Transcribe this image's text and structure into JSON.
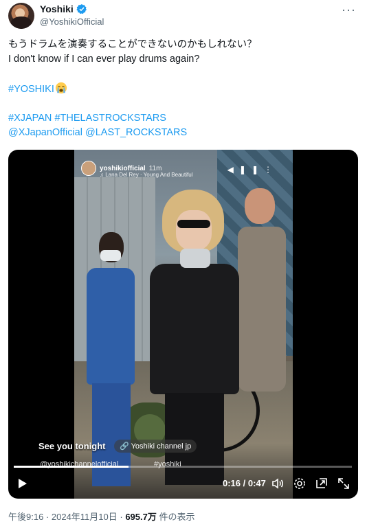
{
  "user": {
    "display_name": "Yoshiki",
    "handle": "@YoshikiOfficial",
    "verified": true
  },
  "tweet": {
    "text_jp": "もうドラムを演奏することができないのかもしれない？",
    "text_en": "I don't know if I can ever play drums again?",
    "hashtag_main": "#YOSHIKI",
    "emoji": "crying-face-emoji",
    "hashtag_xjapan": "#XJAPAN",
    "hashtag_lastrockstars": "#THELASTROCKSTARS",
    "mention_xjapan": "@XJapanOfficial",
    "mention_lastrockstars": "@LAST_ROCKSTARS"
  },
  "video": {
    "story_user": "yoshikiofficial",
    "story_time": "11m",
    "story_song": "♫ Lana Del Rey · Young And Beautiful",
    "overlay_text": "See you tonight",
    "channel_label": "Yoshiki channel jp",
    "tag_official": "@yoshikichannelofficial",
    "tag_yoshiki": "#yoshiki",
    "current_time": "0:16",
    "separator": " / ",
    "duration": "0:47",
    "progress": 0.34
  },
  "meta": {
    "time": "午後9:16",
    "dot1": " · ",
    "date": "2024年11月10日",
    "dot2": " · ",
    "views": "695.7万",
    "views_label": " 件の表示"
  },
  "colors": {
    "link": "#1d9bf0",
    "verified": "#1d9bf0",
    "muted": "#536471",
    "text": "#0f1419"
  }
}
